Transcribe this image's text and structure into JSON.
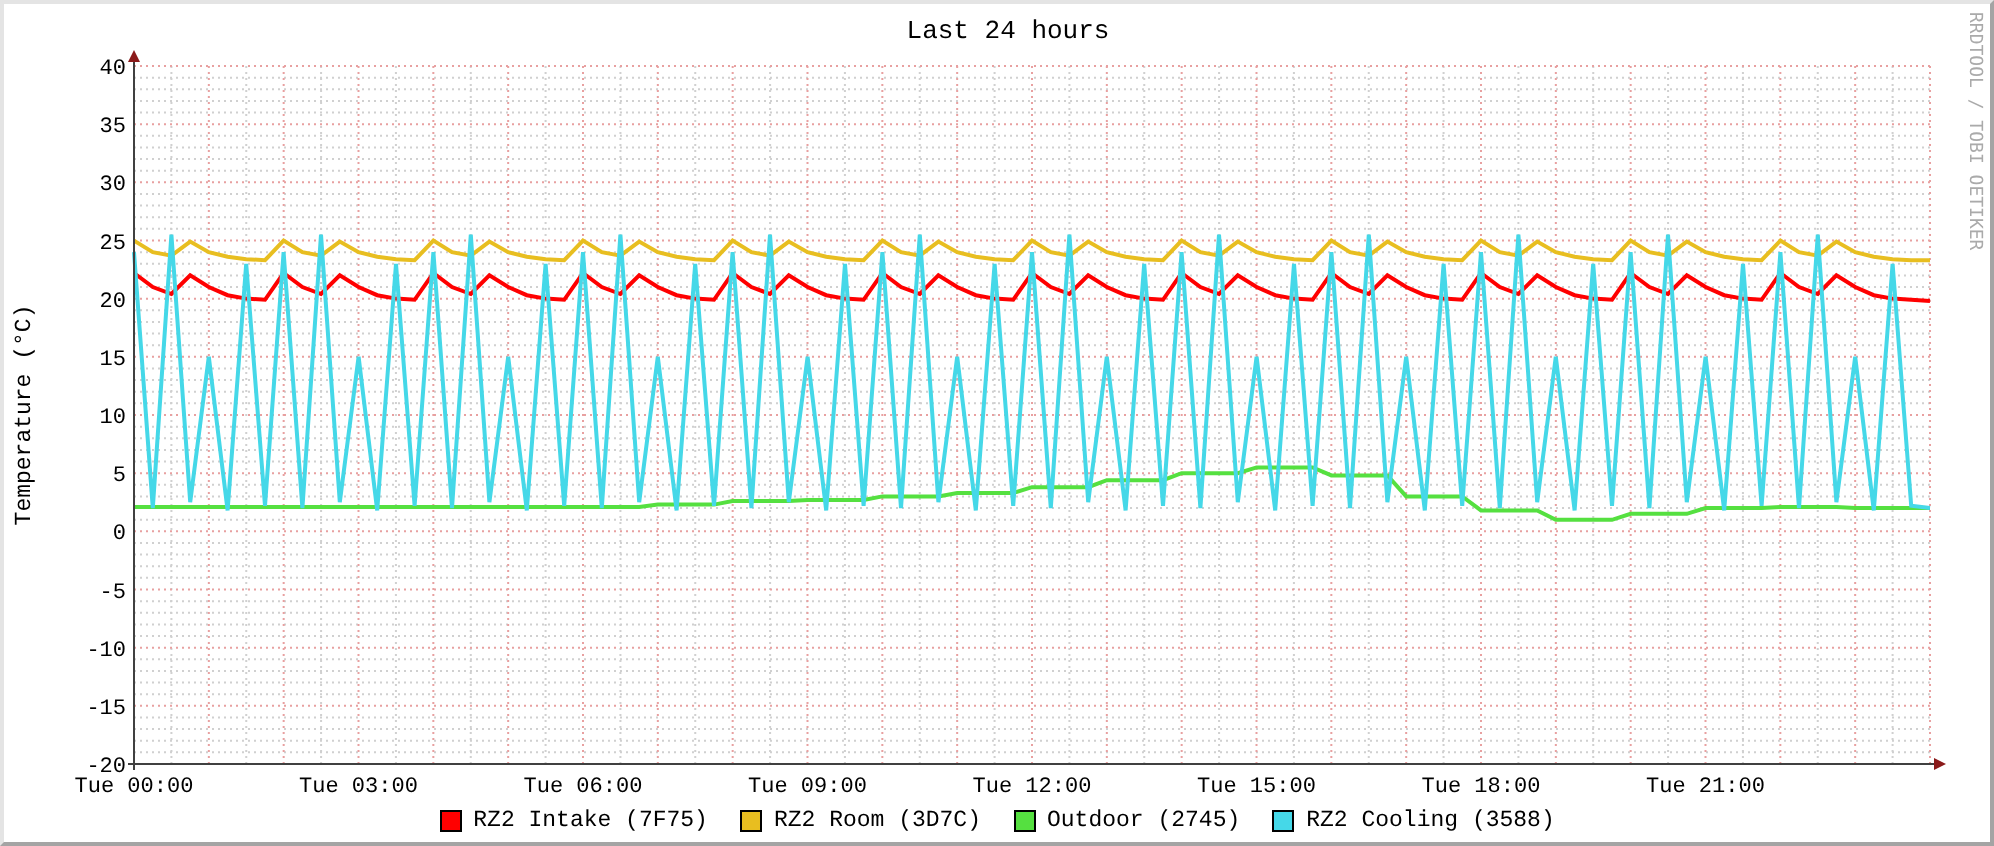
{
  "graph": {
    "credit": "RRDTOOL / TOBI OETIKER",
    "chart_data": {
      "type": "line",
      "grid": true,
      "title": "Last 24 hours",
      "ylabel": "Temperature (°C)",
      "ylim": [
        -20,
        40
      ],
      "categories": [
        "Tue 00:00",
        null,
        null,
        null,
        null,
        null,
        null,
        null,
        null,
        null,
        null,
        null,
        "Tue 03:00",
        null,
        null,
        null,
        null,
        null,
        null,
        null,
        null,
        null,
        null,
        null,
        "Tue 06:00",
        null,
        null,
        null,
        null,
        null,
        null,
        null,
        null,
        null,
        null,
        null,
        "Tue 09:00",
        null,
        null,
        null,
        null,
        null,
        null,
        null,
        null,
        null,
        null,
        null,
        "Tue 12:00",
        null,
        null,
        null,
        null,
        null,
        null,
        null,
        null,
        null,
        null,
        null,
        "Tue 15:00",
        null,
        null,
        null,
        null,
        null,
        null,
        null,
        null,
        null,
        null,
        null,
        "Tue 18:00",
        null,
        null,
        null,
        null,
        null,
        null,
        null,
        null,
        null,
        null,
        null,
        "Tue 21:00",
        null,
        null,
        null,
        null,
        null,
        null,
        null,
        null,
        null,
        null,
        null,
        null
      ],
      "yticks": [
        -20,
        -15,
        -10,
        -5,
        0,
        5,
        10,
        15,
        20,
        25,
        30,
        35,
        40
      ],
      "series": [
        {
          "name": "RZ2 Intake (7F75)",
          "color": "#ff0000",
          "values": [
            22.2,
            21.0,
            20.4,
            22.0,
            21.0,
            20.3,
            20.0,
            19.9,
            22.2,
            21.0,
            20.4,
            22.0,
            21.0,
            20.3,
            20.0,
            19.9,
            22.2,
            21.0,
            20.4,
            22.0,
            21.0,
            20.3,
            20.0,
            19.9,
            22.2,
            21.0,
            20.4,
            22.0,
            21.0,
            20.3,
            20.0,
            19.9,
            22.2,
            21.0,
            20.4,
            22.0,
            21.0,
            20.3,
            20.0,
            19.9,
            22.2,
            21.0,
            20.4,
            22.0,
            21.0,
            20.3,
            20.0,
            19.9,
            22.2,
            21.0,
            20.4,
            22.0,
            21.0,
            20.3,
            20.0,
            19.9,
            22.2,
            21.0,
            20.4,
            22.0,
            21.0,
            20.3,
            20.0,
            19.9,
            22.2,
            21.0,
            20.4,
            22.0,
            21.0,
            20.3,
            20.0,
            19.9,
            22.2,
            21.0,
            20.4,
            22.0,
            21.0,
            20.3,
            20.0,
            19.9,
            22.2,
            21.0,
            20.4,
            22.0,
            21.0,
            20.3,
            20.0,
            19.9,
            22.2,
            21.0,
            20.4,
            22.0,
            21.0,
            20.3,
            20.0,
            19.9,
            19.8
          ]
        },
        {
          "name": "RZ2 Room (3D7C)",
          "color": "#e8be20",
          "values": [
            25.0,
            24.0,
            23.7,
            24.9,
            24.0,
            23.6,
            23.4,
            23.3,
            25.0,
            24.0,
            23.7,
            24.9,
            24.0,
            23.6,
            23.4,
            23.3,
            25.0,
            24.0,
            23.7,
            24.9,
            24.0,
            23.6,
            23.4,
            23.3,
            25.0,
            24.0,
            23.7,
            24.9,
            24.0,
            23.6,
            23.4,
            23.3,
            25.0,
            24.0,
            23.7,
            24.9,
            24.0,
            23.6,
            23.4,
            23.3,
            25.0,
            24.0,
            23.7,
            24.9,
            24.0,
            23.6,
            23.4,
            23.3,
            25.0,
            24.0,
            23.7,
            24.9,
            24.0,
            23.6,
            23.4,
            23.3,
            25.0,
            24.0,
            23.7,
            24.9,
            24.0,
            23.6,
            23.4,
            23.3,
            25.0,
            24.0,
            23.7,
            24.9,
            24.0,
            23.6,
            23.4,
            23.3,
            25.0,
            24.0,
            23.7,
            24.9,
            24.0,
            23.6,
            23.4,
            23.3,
            25.0,
            24.0,
            23.7,
            24.9,
            24.0,
            23.6,
            23.4,
            23.3,
            25.0,
            24.0,
            23.7,
            24.9,
            24.0,
            23.6,
            23.4,
            23.3,
            23.3
          ]
        },
        {
          "name": "Outdoor (2745)",
          "color": "#55e040",
          "values": [
            2.1,
            2.1,
            2.1,
            2.1,
            2.1,
            2.1,
            2.1,
            2.1,
            2.1,
            2.1,
            2.1,
            2.1,
            2.1,
            2.1,
            2.1,
            2.1,
            2.1,
            2.1,
            2.1,
            2.1,
            2.1,
            2.1,
            2.1,
            2.1,
            2.1,
            2.1,
            2.1,
            2.1,
            2.3,
            2.3,
            2.3,
            2.3,
            2.6,
            2.6,
            2.6,
            2.6,
            2.7,
            2.7,
            2.7,
            2.7,
            3.0,
            3.0,
            3.0,
            3.0,
            3.3,
            3.3,
            3.3,
            3.3,
            3.8,
            3.8,
            3.8,
            3.8,
            4.4,
            4.4,
            4.4,
            4.4,
            5.0,
            5.0,
            5.0,
            5.0,
            5.5,
            5.5,
            5.5,
            5.5,
            4.8,
            4.8,
            4.8,
            4.8,
            3.0,
            3.0,
            3.0,
            3.0,
            1.8,
            1.8,
            1.8,
            1.8,
            1.0,
            1.0,
            1.0,
            1.0,
            1.5,
            1.5,
            1.5,
            1.5,
            2.0,
            2.0,
            2.0,
            2.0,
            2.1,
            2.1,
            2.1,
            2.1,
            2.0,
            2.0,
            2.0,
            2.0,
            2.0
          ]
        },
        {
          "name": "RZ2 Cooling (3588)",
          "color": "#45d8e8",
          "values": [
            24.0,
            2.0,
            25.5,
            2.5,
            15.0,
            1.8,
            23.0,
            2.2,
            24.0,
            2.0,
            25.5,
            2.5,
            15.0,
            1.8,
            23.0,
            2.2,
            24.0,
            2.0,
            25.5,
            2.5,
            15.0,
            1.8,
            23.0,
            2.2,
            24.0,
            2.0,
            25.5,
            2.5,
            15.0,
            1.8,
            23.0,
            2.2,
            24.0,
            2.0,
            25.5,
            2.5,
            15.0,
            1.8,
            23.0,
            2.2,
            24.0,
            2.0,
            25.5,
            2.5,
            15.0,
            1.8,
            23.0,
            2.2,
            24.0,
            2.0,
            25.5,
            2.5,
            15.0,
            1.8,
            23.0,
            2.2,
            24.0,
            2.0,
            25.5,
            2.5,
            15.0,
            1.8,
            23.0,
            2.2,
            24.0,
            2.0,
            25.5,
            2.5,
            15.0,
            1.8,
            23.0,
            2.2,
            24.0,
            2.0,
            25.5,
            2.5,
            15.0,
            1.8,
            23.0,
            2.2,
            24.0,
            2.0,
            25.5,
            2.5,
            15.0,
            1.8,
            23.0,
            2.2,
            24.0,
            2.0,
            25.5,
            2.5,
            15.0,
            1.8,
            23.0,
            2.2,
            2.0
          ]
        }
      ]
    }
  }
}
